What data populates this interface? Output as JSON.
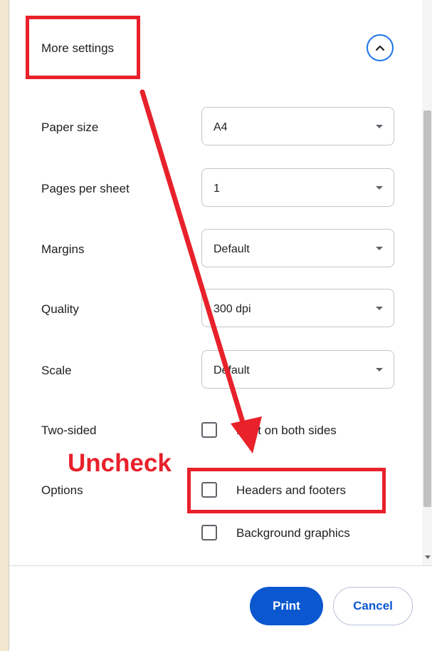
{
  "more_settings": {
    "label": "More settings"
  },
  "settings": [
    {
      "label": "Paper size",
      "value": "A4"
    },
    {
      "label": "Pages per sheet",
      "value": "1"
    },
    {
      "label": "Margins",
      "value": "Default"
    },
    {
      "label": "Quality",
      "value": "300 dpi"
    },
    {
      "label": "Scale",
      "value": "Default"
    }
  ],
  "two_sided": {
    "label": "Two-sided",
    "option": "Print on both sides",
    "checked": false
  },
  "options": {
    "label": "Options",
    "items": [
      {
        "label": "Headers and footers",
        "checked": false
      },
      {
        "label": "Background graphics",
        "checked": false
      }
    ]
  },
  "footer": {
    "print_label": "Print",
    "cancel_label": "Cancel"
  },
  "annotation": {
    "text": "Uncheck",
    "color": "#e8212b"
  },
  "colors": {
    "accent": "#0b57d0",
    "annotation": "#e8212b"
  },
  "icons": {
    "collapse": "chevron-up-icon",
    "dropdown": "caret-down-icon"
  }
}
